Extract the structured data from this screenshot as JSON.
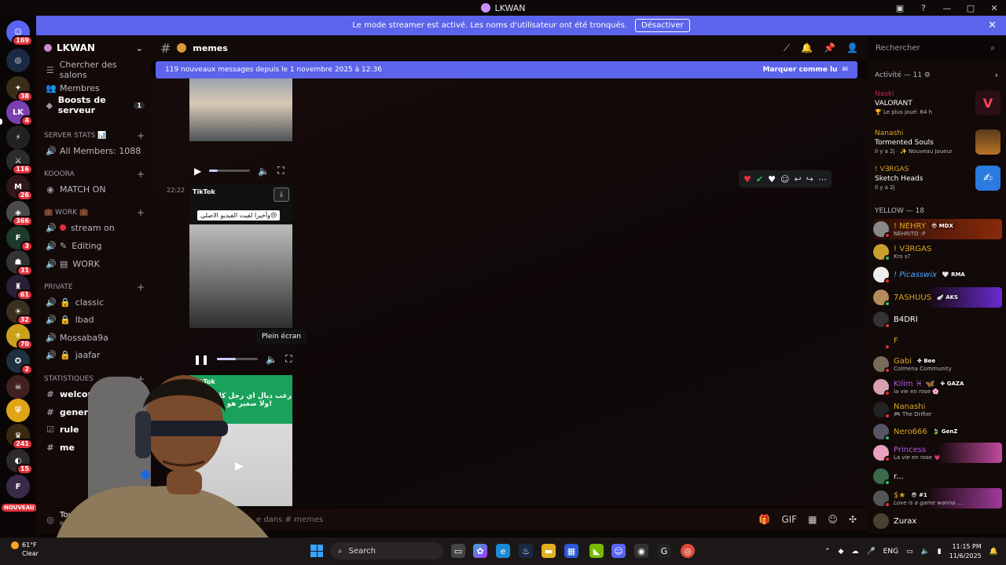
{
  "window": {
    "title": "LKWAN"
  },
  "banner": {
    "text": "Le mode streamer est activé. Les noms d'utilisateur ont été tronqués.",
    "button": "Désactiver"
  },
  "rail": {
    "badges": [
      "169",
      "38",
      "4",
      "116",
      "26",
      "366",
      "3",
      "31",
      "61",
      "32",
      "70",
      "2",
      "241",
      "15"
    ],
    "new_label": "NOUVEAU"
  },
  "sidebar": {
    "guild": "LKWAN",
    "items": {
      "browse": "Chercher des salons",
      "members": "Membres",
      "boosts": "Boosts de serveur",
      "boosts_count": "1"
    },
    "categories": {
      "server_stats": "SERVER STATS 📊",
      "koora": "KOOORA",
      "work": "💼 work 💼",
      "private": "PRIVATE",
      "stats": "STATISTIQUES"
    },
    "channels": {
      "all_members": "All Members: 1088",
      "match_on": "MATCH ON",
      "stream_on": "stream on",
      "editing": "Editing",
      "work": "WORK",
      "classic": "classic",
      "lbad": "lbad",
      "mossaba9a": "Mossaba9a",
      "jaafar": "jaafar",
      "welcome": "welcom",
      "general": "gener",
      "rules": "rule",
      "memes": "me"
    },
    "user": {
      "name": "Tou",
      "status": "Invisi"
    }
  },
  "header": {
    "channel": "memes",
    "search_placeholder": "Rechercher"
  },
  "new_messages": {
    "text": "119 nouveaux messages depuis le 1 novembre 2025 à 12:36",
    "mark_read": "Marquer comme lu"
  },
  "chat": {
    "timestamp": "22:22",
    "tiktok": "TikTok",
    "caption_video2": "وأخيرا لقيت الفيديو الاصلي😢",
    "caption_video3": "رعب ديال اي رجل كان ولا صغير هو هدا!",
    "tooltip": "Plein écran",
    "video2_progress": 0.45
  },
  "composer": {
    "placeholder": "e dans # memes"
  },
  "activity": {
    "title": "Activité — 11 ⚙",
    "entries": [
      {
        "user": "Naski",
        "game": "VALORANT",
        "sub": "🏆 Le plus joué: 64 h"
      },
      {
        "user": "Nanashi",
        "game": "Tormented Souls",
        "sub": "Il y a 2j · ✨ Nouveau joueur"
      },
      {
        "user": "! V∃RGAS",
        "game": "Sketch Heads",
        "sub": "Il y a 2j"
      }
    ]
  },
  "members": {
    "role_header": "YELLOW — 18",
    "list": [
      {
        "name": "! NEHRY",
        "tag": "😎 MDX",
        "sub": "NEHRITO :P"
      },
      {
        "name": "! V∃RGAS",
        "tag": "",
        "sub": "Kro s?"
      },
      {
        "name": "! Picasswix",
        "tag": "🤍 RMA",
        "sub": ""
      },
      {
        "name": "7ASHUUS",
        "tag": "🪽 AKS",
        "sub": ""
      },
      {
        "name": "B4DRI",
        "tag": "",
        "sub": ""
      },
      {
        "name": "F",
        "tag": "",
        "sub": ""
      },
      {
        "name": "Gabi",
        "tag": "✤ Bee",
        "sub": "Colmena Community"
      },
      {
        "name": "Kilim ♓ 🦋",
        "tag": "✤ GAZA",
        "sub": "la vie en rose 🌸"
      },
      {
        "name": "Nanashi",
        "tag": "",
        "sub": "🎮 The Drifter"
      },
      {
        "name": "Nero666",
        "tag": "🍃 GenZ",
        "sub": ""
      },
      {
        "name": "Princess",
        "tag": "",
        "sub": "La vie en rose 💗"
      },
      {
        "name": "r...",
        "tag": "",
        "sub": ""
      },
      {
        "name": "$★",
        "tag": "😎 #1",
        "sub": "Love is a game wanna ..."
      },
      {
        "name": "Zurax",
        "tag": "",
        "sub": ""
      }
    ]
  },
  "taskbar": {
    "weather_temp": "61°F",
    "weather_cond": "Clear",
    "search": "Search",
    "lang": "ENG",
    "time": "11:15 PM",
    "date": "11/6/2025"
  },
  "colors": {
    "accent": "#5b64ea",
    "yellow_role": "#d9a820",
    "badge": "#e0323c"
  }
}
